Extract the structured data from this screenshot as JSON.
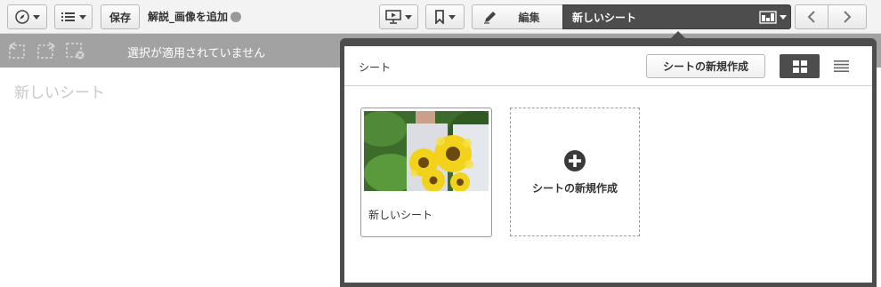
{
  "toolbar": {
    "compass_icon": "compass-icon",
    "list_icon": "list-icon",
    "save_label": "保存",
    "doc_title": "解説_画像を追加",
    "present_icon": "presentation-icon",
    "bookmark_icon": "bookmark-icon",
    "edit_label": "編集",
    "current_sheet": "新しいシート",
    "sheet_thumb_icon": "sheet-thumbnail-icon",
    "accent": "#4d4d4d"
  },
  "selection_bar": {
    "message": "選択が適用されていません"
  },
  "sheet_area": {
    "sheet_title_placeholder": "新しいシート"
  },
  "popup": {
    "title": "シート",
    "create_button": "シートの新規作成",
    "view_grid_icon": "grid-view-icon",
    "view_list_icon": "list-view-icon",
    "cards": [
      {
        "label": "新しいシート"
      }
    ],
    "new_card_label": "シートの新規作成"
  }
}
